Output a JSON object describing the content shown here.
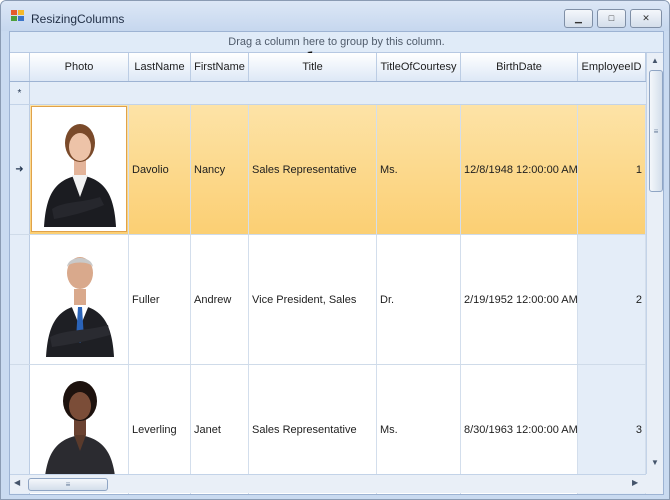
{
  "window": {
    "title": "ResizingColumns",
    "minimize_glyph": "▁",
    "maximize_glyph": "□",
    "close_glyph": "✕"
  },
  "grid": {
    "group_panel_text": "Drag a column here to group by this column.",
    "new_row_marker": "*",
    "current_row_marker": "➜",
    "columns": [
      "Photo",
      "LastName",
      "FirstName",
      "Title",
      "TitleOfCourtesy",
      "BirthDate",
      "EmployeeID"
    ],
    "rows": [
      {
        "last_name": "Davolio",
        "first_name": "Nancy",
        "title": "Sales Representative",
        "courtesy": "Ms.",
        "birth_date": "12/8/1948 12:00:00 AM",
        "employee_id": "1",
        "photo": "woman-in-black-suit"
      },
      {
        "last_name": "Fuller",
        "first_name": "Andrew",
        "title": "Vice President, Sales",
        "courtesy": "Dr.",
        "birth_date": "2/19/1952 12:00:00 AM",
        "employee_id": "2",
        "photo": "man-in-suit-blue-tie"
      },
      {
        "last_name": "Leverling",
        "first_name": "Janet",
        "title": "Sales Representative",
        "courtesy": "Ms.",
        "birth_date": "8/30/1963 12:00:00 AM",
        "employee_id": "3",
        "photo": "woman-in-dark-blazer"
      }
    ]
  },
  "scrollbars": {
    "up": "▲",
    "down": "▼",
    "left": "◀",
    "right": "▶",
    "grip": "≡"
  },
  "colors": {
    "selected_row_top": "#fde3a7",
    "selected_row_bottom": "#fbcf73",
    "header_border": "#9db3d3"
  }
}
